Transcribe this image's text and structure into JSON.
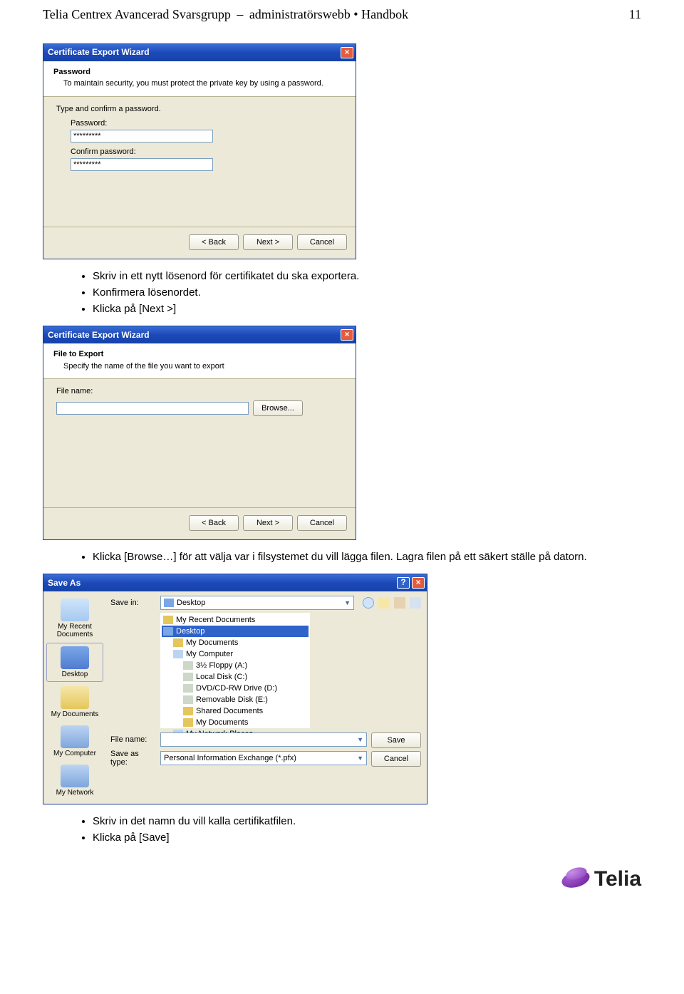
{
  "header": {
    "product": "Telia Centrex Avancerad Svarsgrupp",
    "section": "administratörswebb",
    "doc_type": "Handbok",
    "page": "11"
  },
  "wizard1": {
    "title": "Certificate Export Wizard",
    "head_h1": "Password",
    "head_h2": "To maintain security, you must protect the private key by using a password.",
    "group_label": "Type and confirm a password.",
    "pw_label": "Password:",
    "pw_value": "*********",
    "confirm_label": "Confirm password:",
    "confirm_value": "*********",
    "back": "< Back",
    "next": "Next >",
    "cancel": "Cancel"
  },
  "bullets1": [
    "Skriv in ett nytt lösenord för certifikatet du ska exportera.",
    "Konfirmera lösenordet.",
    "Klicka på [Next >]"
  ],
  "wizard2": {
    "title": "Certificate Export Wizard",
    "head_h1": "File to Export",
    "head_h2": "Specify the name of the file you want to export",
    "file_label": "File name:",
    "file_value": "",
    "browse": "Browse...",
    "back": "< Back",
    "next": "Next >",
    "cancel": "Cancel"
  },
  "bullets2": [
    "Klicka [Browse…] för att välja var i filsystemet du vill lägga filen. Lagra filen på ett säkert ställe på datorn."
  ],
  "saveas": {
    "title": "Save As",
    "savein_label": "Save in:",
    "savein_value": "Desktop",
    "places": {
      "recent": "My Recent Documents",
      "desktop": "Desktop",
      "mydocs": "My Documents",
      "mycomp": "My Computer",
      "mynet": "My Network"
    },
    "list": [
      "My Recent Documents",
      "Desktop",
      "My Documents",
      "My Computer",
      "3½ Floppy (A:)",
      "Local Disk (C:)",
      "DVD/CD-RW Drive (D:)",
      "Removable Disk (E:)",
      "Shared Documents",
      "My Documents",
      "My Network Places"
    ],
    "selected_index": 1,
    "filename_label": "File name:",
    "filename_value": "",
    "savetype_label": "Save as type:",
    "savetype_value": "Personal Information Exchange (*.pfx)",
    "save": "Save",
    "cancel": "Cancel"
  },
  "bullets3": [
    "Skriv in det namn du vill kalla certifikatfilen.",
    "Klicka på [Save]"
  ],
  "logo_text": "Telia"
}
